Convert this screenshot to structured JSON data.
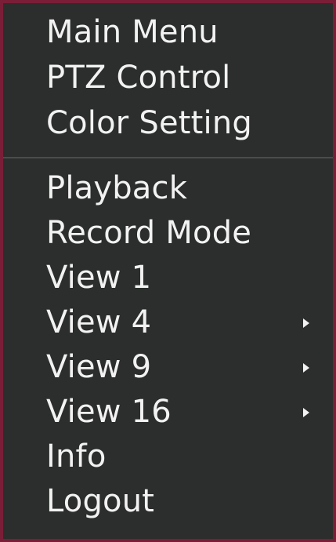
{
  "menu": {
    "top_items": [
      {
        "label": "Main Menu"
      },
      {
        "label": "PTZ Control"
      },
      {
        "label": "Color Setting"
      }
    ],
    "bottom_items": [
      {
        "label": "Playback",
        "submenu": false
      },
      {
        "label": "Record Mode",
        "submenu": false
      },
      {
        "label": "View 1",
        "submenu": false
      },
      {
        "label": "View 4",
        "submenu": true
      },
      {
        "label": "View 9",
        "submenu": true
      },
      {
        "label": "View 16",
        "submenu": true
      },
      {
        "label": "Info",
        "submenu": false
      },
      {
        "label": "Logout",
        "submenu": false
      }
    ],
    "colors": {
      "background": "#2b2e2c",
      "border": "#7a1e37",
      "text": "#f2f2f2",
      "divider": "#4a4d4b"
    },
    "submenu_icon": "triangle-right-icon"
  }
}
